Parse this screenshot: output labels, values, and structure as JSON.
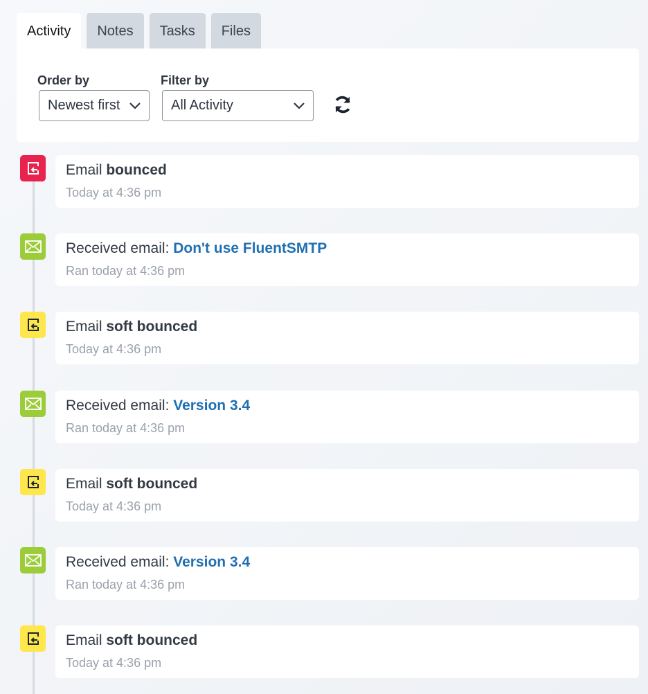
{
  "tabs": [
    "Activity",
    "Notes",
    "Tasks",
    "Files"
  ],
  "controls": {
    "order_label": "Order by",
    "order_value": "Newest first",
    "filter_label": "Filter by",
    "filter_value": "All Activity"
  },
  "colors": {
    "bounced": "#e8234f",
    "received": "#9ccc3a",
    "soft_bounced": "#fde74c",
    "link": "#1f6fb2"
  },
  "items": [
    {
      "type": "bounced",
      "prefix": "Email ",
      "bold": "bounced",
      "link": "",
      "time": "Today at 4:36 pm",
      "icon": "bounce-icon"
    },
    {
      "type": "received",
      "prefix": "Received email: ",
      "bold": "",
      "link": "Don't use FluentSMTP",
      "time": "Ran today at 4:36 pm",
      "icon": "envelope-icon"
    },
    {
      "type": "soft_bounced",
      "prefix": "Email ",
      "bold": "soft bounced",
      "link": "",
      "time": "Today at 4:36 pm",
      "icon": "bounce-icon"
    },
    {
      "type": "received",
      "prefix": "Received email: ",
      "bold": "",
      "link": "Version 3.4",
      "time": "Ran today at 4:36 pm",
      "icon": "envelope-icon"
    },
    {
      "type": "soft_bounced",
      "prefix": "Email ",
      "bold": "soft bounced",
      "link": "",
      "time": "Today at 4:36 pm",
      "icon": "bounce-icon"
    },
    {
      "type": "received",
      "prefix": "Received email: ",
      "bold": "",
      "link": "Version 3.4",
      "time": "Ran today at 4:36 pm",
      "icon": "envelope-icon"
    },
    {
      "type": "soft_bounced",
      "prefix": "Email ",
      "bold": "soft bounced",
      "link": "",
      "time": "Today at 4:36 pm",
      "icon": "bounce-icon"
    }
  ]
}
